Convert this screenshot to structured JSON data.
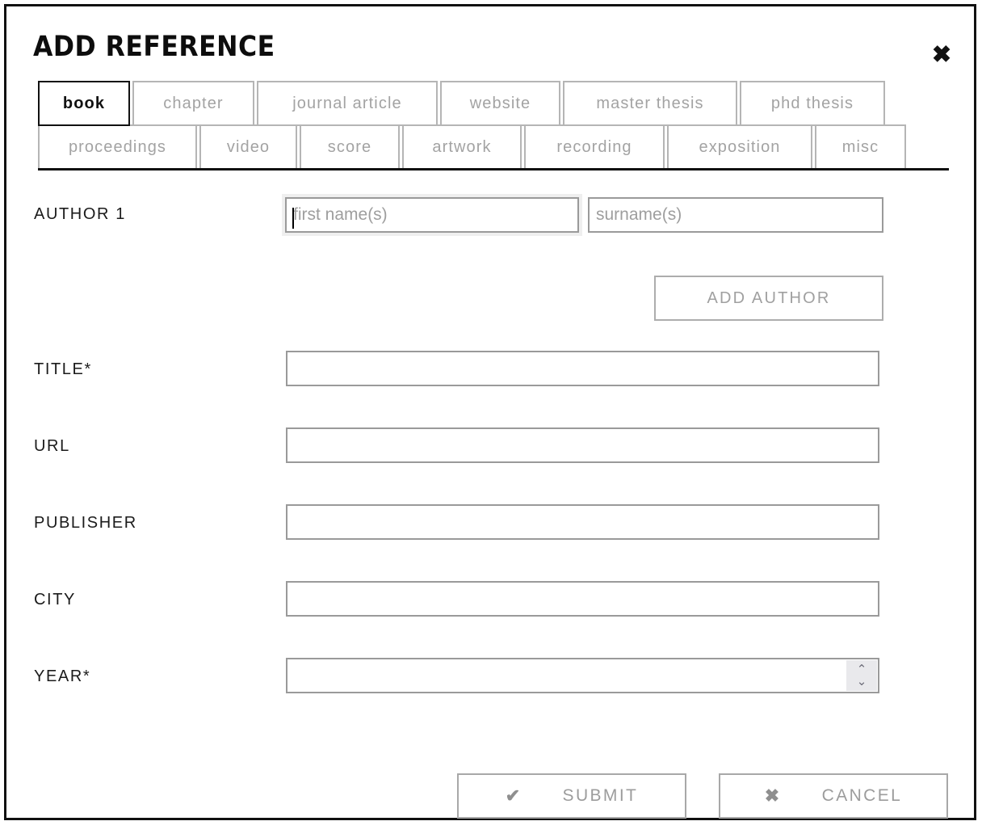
{
  "dialog": {
    "title": "ADD REFERENCE",
    "close_icon": "close-x-icon"
  },
  "tabs": {
    "active": "book",
    "row1": [
      {
        "label": "book",
        "active": true
      },
      {
        "label": "chapter",
        "active": false
      },
      {
        "label": "journal article",
        "active": false
      },
      {
        "label": "website",
        "active": false
      },
      {
        "label": "master thesis",
        "active": false
      },
      {
        "label": "phd thesis",
        "active": false
      }
    ],
    "row2": [
      {
        "label": "proceedings",
        "active": false
      },
      {
        "label": "video",
        "active": false
      },
      {
        "label": "score",
        "active": false
      },
      {
        "label": "artwork",
        "active": false
      },
      {
        "label": "recording",
        "active": false
      },
      {
        "label": "exposition",
        "active": false
      },
      {
        "label": "misc",
        "active": false
      }
    ]
  },
  "form": {
    "author": {
      "label": "AUTHOR 1",
      "first_name_placeholder": "first name(s)",
      "first_name_value": "",
      "surname_placeholder": "surname(s)",
      "surname_value": "",
      "focused_field": "first name(s)"
    },
    "add_author_label": "ADD AUTHOR",
    "fields": [
      {
        "label": "TITLE*",
        "value": "",
        "placeholder": ""
      },
      {
        "label": "URL",
        "value": "",
        "placeholder": ""
      },
      {
        "label": "PUBLISHER",
        "value": "",
        "placeholder": ""
      },
      {
        "label": "CITY",
        "value": "",
        "placeholder": ""
      }
    ],
    "year": {
      "label": "YEAR*",
      "value": "",
      "placeholder": "",
      "spinner_up": "⌃",
      "spinner_down": "⌄"
    }
  },
  "footer": {
    "submit_label": "SUBMIT",
    "submit_icon": "✔",
    "cancel_label": "CANCEL",
    "cancel_icon": "✖"
  },
  "colors": {
    "border_dark": "#111111",
    "border_light": "#b5b5b5",
    "muted_text": "#a3a3a3",
    "focus_ring": "#efefef"
  }
}
